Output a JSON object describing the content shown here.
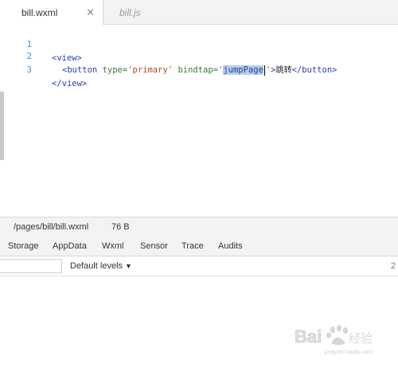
{
  "tabs": [
    {
      "label": "bill.wxml",
      "active": true
    },
    {
      "label": "bill.js",
      "active": false
    }
  ],
  "tab_close_icon": "close-icon",
  "code": {
    "lines": [
      {
        "number": "1",
        "text": "<view>"
      },
      {
        "number": "2",
        "text": "<button type='primary' bindtap='jumpPage'>跳转</button>"
      },
      {
        "number": "3",
        "text": "</view>"
      }
    ],
    "line2": {
      "open": "<button",
      "type_attr": "type=",
      "type_val": "'primary'",
      "bind_attr": "bindtap=",
      "quote_open": "'",
      "selected": "jumpPage",
      "quote_close": "'",
      "close_bracket": ">",
      "text": "跳转",
      "end_tag": "</button>"
    },
    "line1_tag": "<view>",
    "line3_tag": "</view>"
  },
  "status": {
    "path": "/pages/bill/bill.wxml",
    "size": "76 B"
  },
  "panel_tabs": [
    "Storage",
    "AppData",
    "Wxml",
    "Sensor",
    "Trace",
    "Audits"
  ],
  "console": {
    "filter_placeholder": "",
    "levels_label": "Default levels",
    "levels_arrow_icon": "caret-down-icon",
    "count": "2"
  },
  "watermark": {
    "brand": "Bai",
    "suffix": "经验",
    "sub": "jingyan.baidu.com"
  },
  "colors": {
    "line_number": "#3b8fd6",
    "tag": "#2a3fa8",
    "attribute": "#3a7a3a",
    "string": "#b04a1b",
    "selection": "#b8cde9"
  }
}
